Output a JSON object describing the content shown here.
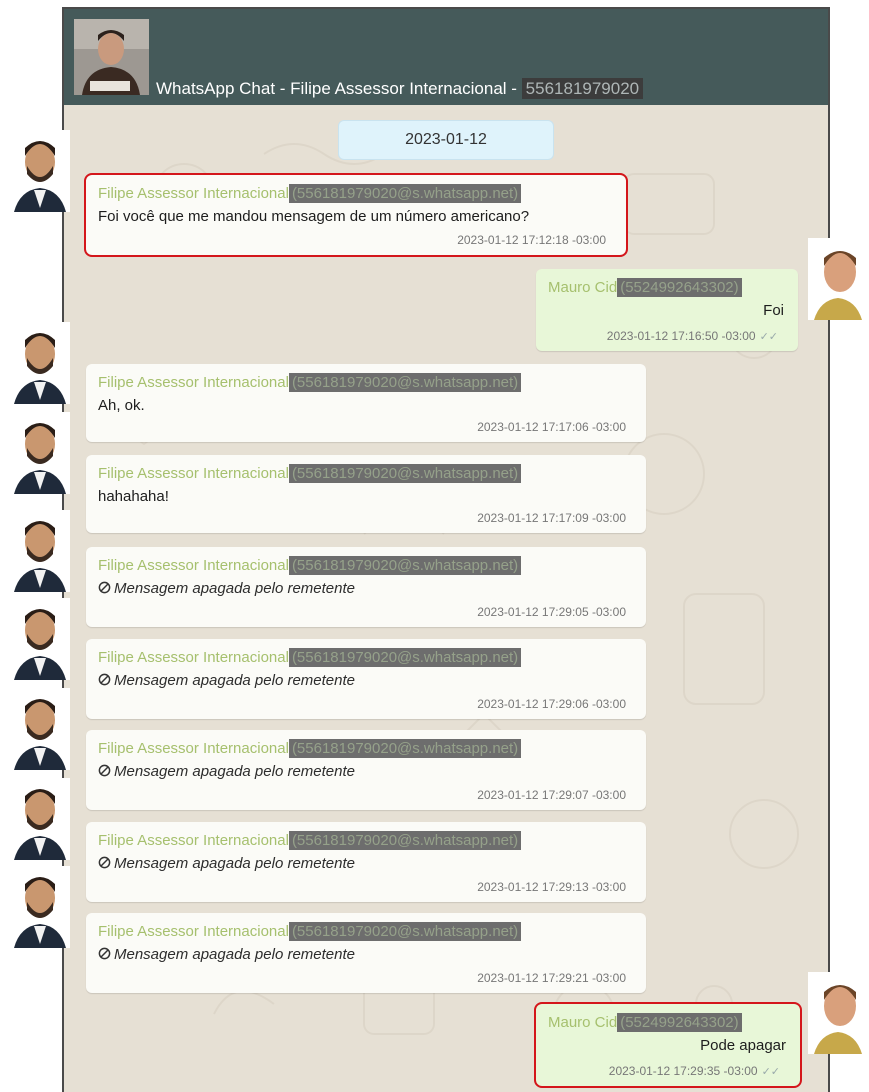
{
  "header": {
    "title": "WhatsApp Chat - Filipe Assessor Internacional -",
    "number": "556181979020"
  },
  "date_divider": "2023-01-12",
  "messages": [
    {
      "sender": "Filipe Assessor Internacional",
      "sender_id": "(556181979020@s.whatsapp.net)",
      "text": "Foi você que me mandou mensagem de um número americano?",
      "time": "2023-01-12 17:12:18 -03:00"
    },
    {
      "sender": "Mauro Cid",
      "sender_id": "(5524992643302)",
      "text": "Foi",
      "time": "2023-01-12 17:16:50 -03:00",
      "ticks": "✓✓"
    },
    {
      "sender": "Filipe Assessor Internacional",
      "sender_id": "(556181979020@s.whatsapp.net)",
      "text": "Ah, ok.",
      "time": "2023-01-12 17:17:06 -03:00"
    },
    {
      "sender": "Filipe Assessor Internacional",
      "sender_id": "(556181979020@s.whatsapp.net)",
      "text": "hahahaha!",
      "time": "2023-01-12 17:17:09 -03:00"
    },
    {
      "sender": "Filipe Assessor Internacional",
      "sender_id": "(556181979020@s.whatsapp.net)",
      "text": "Mensagem apagada pelo remetente",
      "time": "2023-01-12 17:29:05 -03:00"
    },
    {
      "sender": "Filipe Assessor Internacional",
      "sender_id": "(556181979020@s.whatsapp.net)",
      "text": "Mensagem apagada pelo remetente",
      "time": "2023-01-12 17:29:06 -03:00"
    },
    {
      "sender": "Filipe Assessor Internacional",
      "sender_id": "(556181979020@s.whatsapp.net)",
      "text": "Mensagem apagada pelo remetente",
      "time": "2023-01-12 17:29:07 -03:00"
    },
    {
      "sender": "Filipe Assessor Internacional",
      "sender_id": "(556181979020@s.whatsapp.net)",
      "text": "Mensagem apagada pelo remetente",
      "time": "2023-01-12 17:29:13 -03:00"
    },
    {
      "sender": "Filipe Assessor Internacional",
      "sender_id": "(556181979020@s.whatsapp.net)",
      "text": "Mensagem apagada pelo remetente",
      "time": "2023-01-12 17:29:21 -03:00"
    },
    {
      "sender": "Mauro Cid",
      "sender_id": "(5524992643302)",
      "text": "Pode apagar",
      "time": "2023-01-12 17:29:35 -03:00",
      "ticks": "✓✓"
    }
  ],
  "colors": {
    "header_bg": "#455a5a",
    "chat_bg": "#e6e0d4",
    "sender_name": "#a6c06e",
    "outgoing_bubble": "#e8f7d8",
    "highlight_border": "#d4161b"
  },
  "icons": {
    "deleted": "ban-icon",
    "read_receipt": "double-check-icon"
  }
}
